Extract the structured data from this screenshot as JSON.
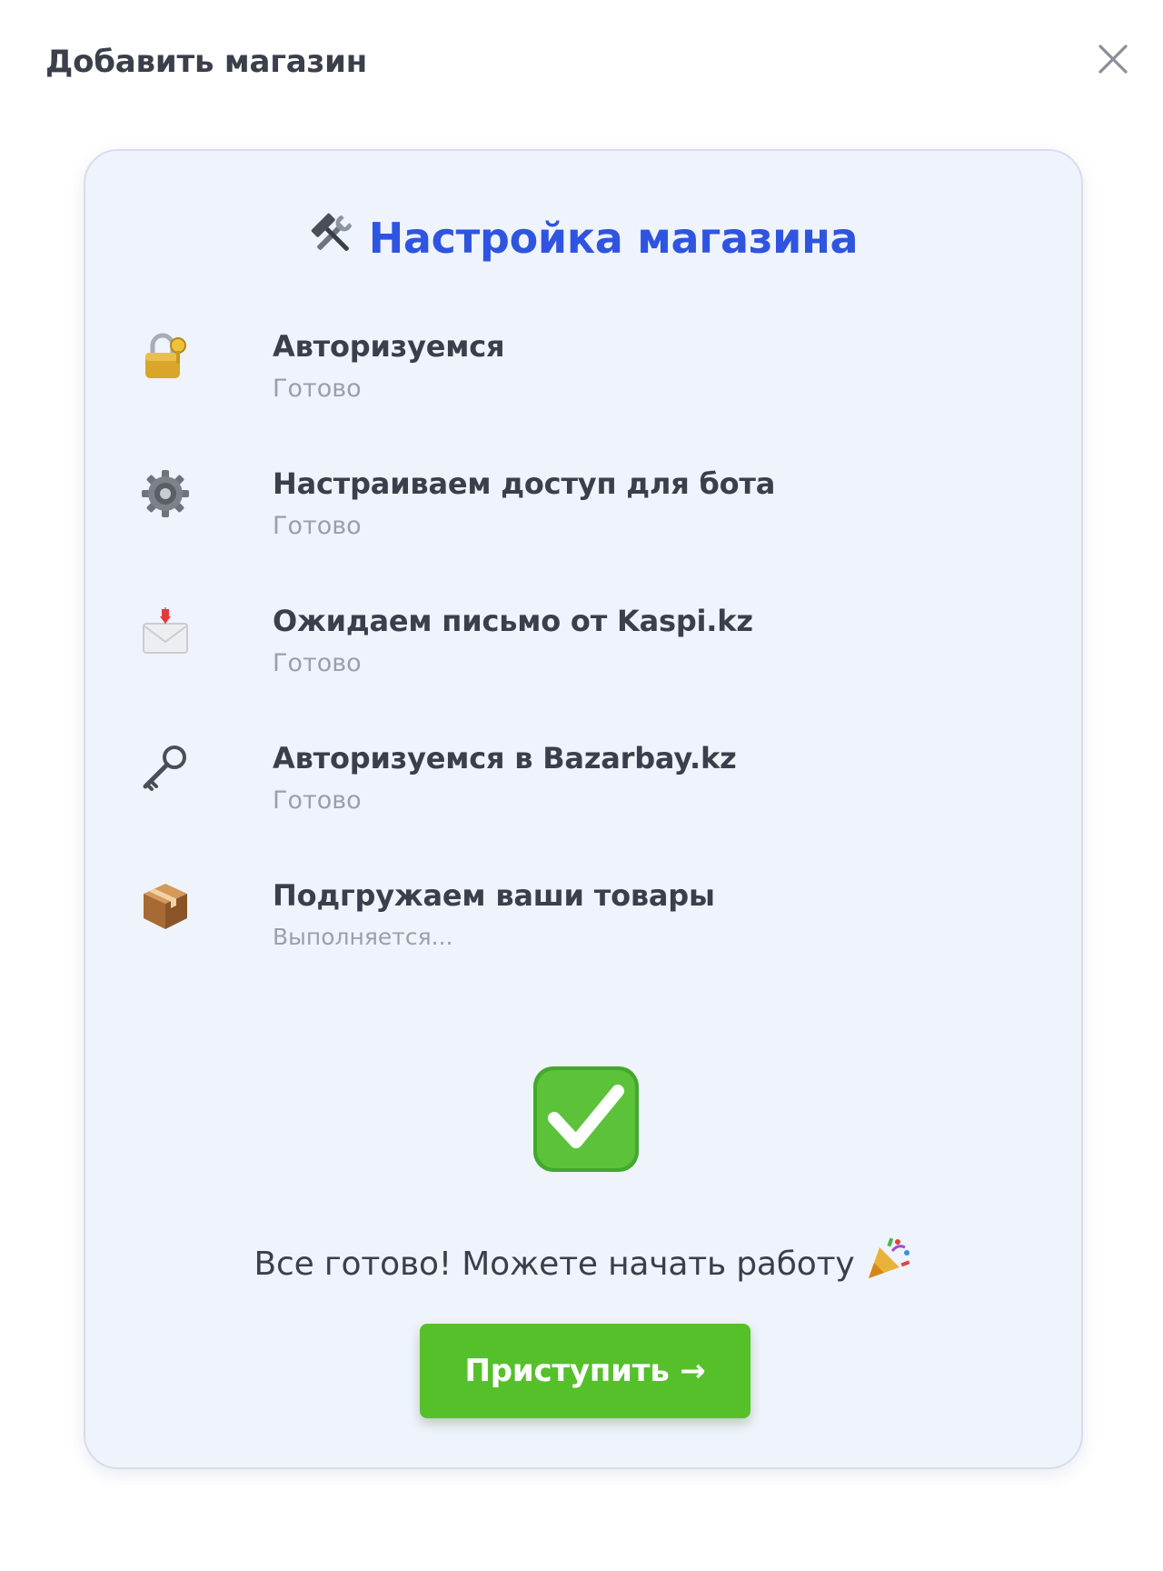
{
  "modal": {
    "title": "Добавить магазин",
    "close_icon": "close-icon"
  },
  "card": {
    "heading": "Настройка магазина",
    "heading_icon": "hammer-and-wrench-icon",
    "steps": [
      {
        "title": "Авторизуемся",
        "status": "Готово",
        "icon": "lock-with-key-icon"
      },
      {
        "title": "Настраиваем доступ для бота",
        "status": "Готово",
        "icon": "gear-icon"
      },
      {
        "title": "Ожидаем письмо от Kaspi.kz",
        "status": "Готово",
        "icon": "envelope-icon"
      },
      {
        "title": "Авторизуемся в Bazarbay.kz",
        "status": "Готово",
        "icon": "key-icon"
      },
      {
        "title": "Подгружаем ваши товары",
        "status": "Выполняется...",
        "icon": "package-icon"
      }
    ],
    "done_icon": "check-mark-button-icon",
    "done_message": "Все готово! Можете начать работу",
    "party_icon": "party-popper-icon",
    "start_button": "Приступить →"
  },
  "colors": {
    "accent": "#2f54e0",
    "button": "#56c02b",
    "card_background": "#eff3fc",
    "muted_text": "#9aa0ab"
  }
}
